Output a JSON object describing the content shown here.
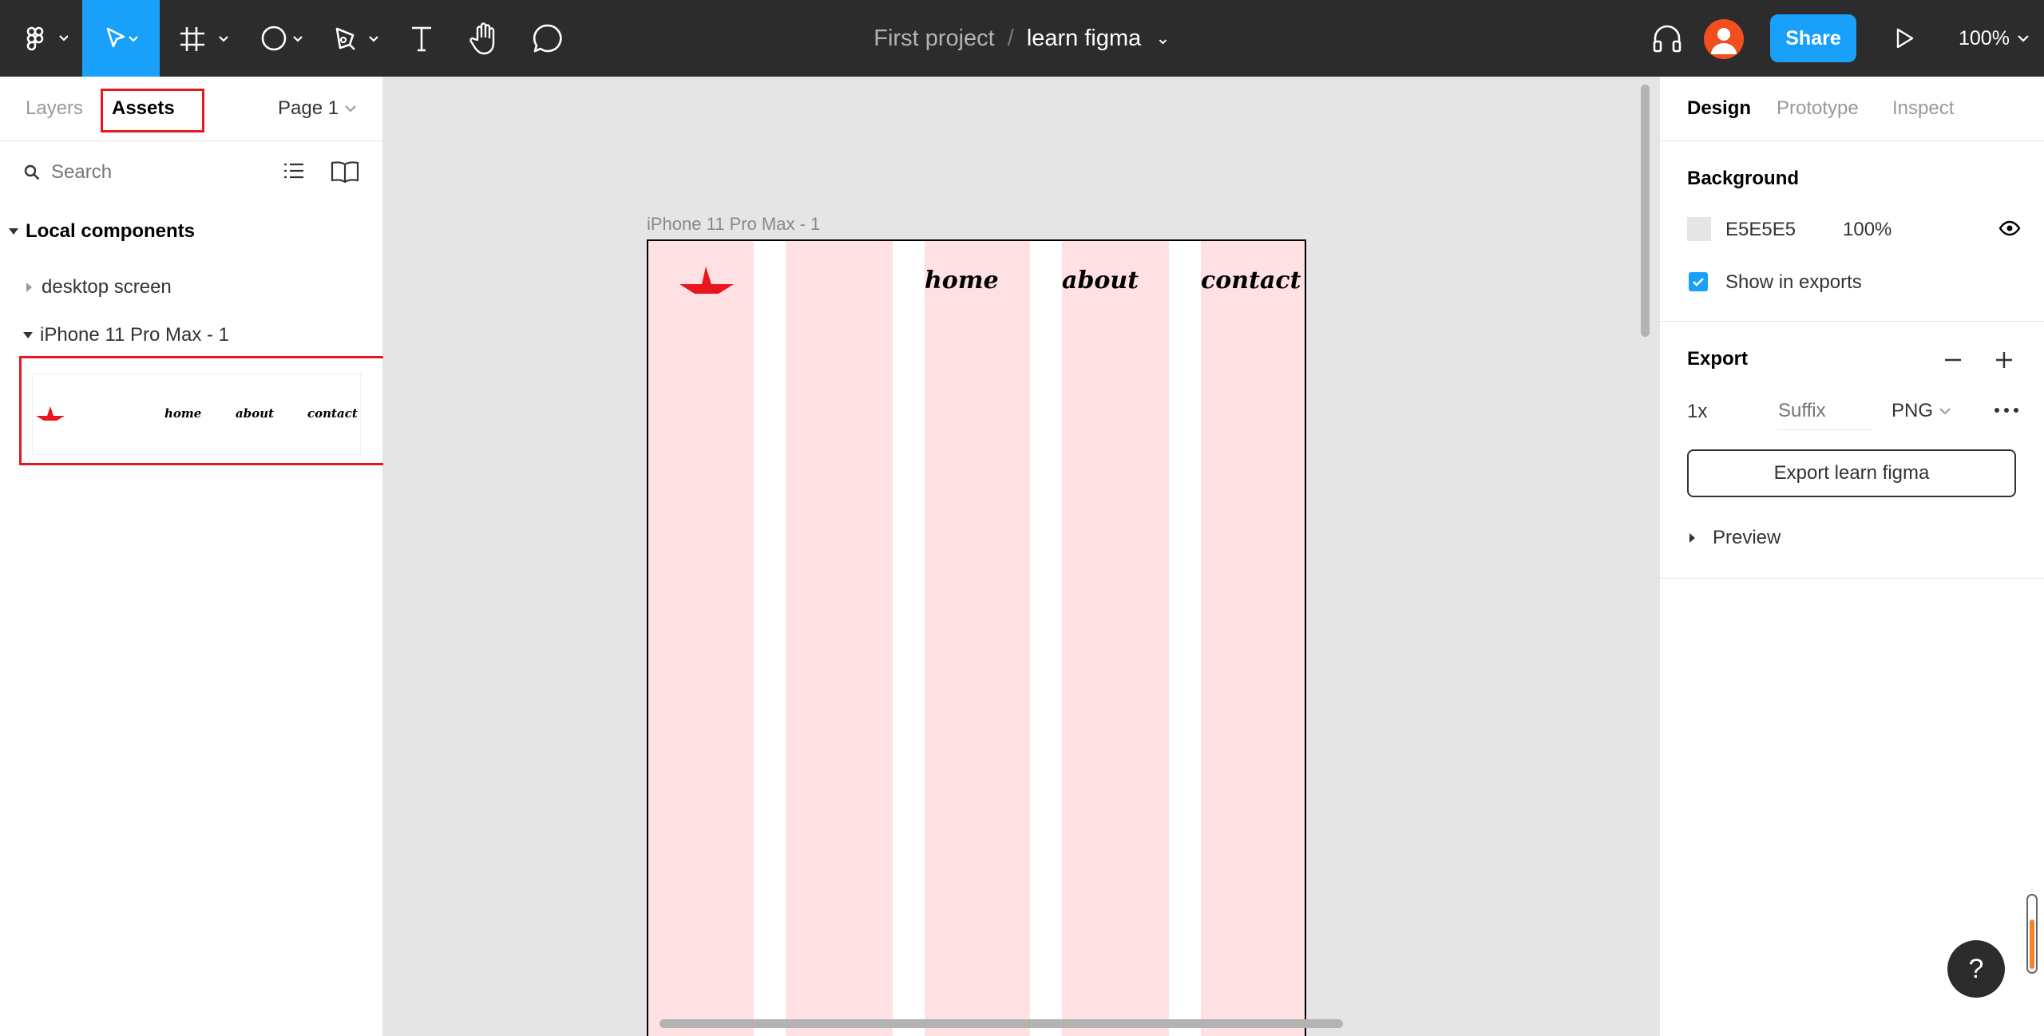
{
  "toolbar": {
    "project": "First project",
    "separator": "/",
    "file_name": "learn figma",
    "share_label": "Share",
    "zoom": "100%",
    "icons": [
      "figma-menu-icon",
      "move-tool-icon",
      "frame-tool-icon",
      "shape-tool-icon",
      "pen-tool-icon",
      "text-tool-icon",
      "hand-tool-icon",
      "comment-tool-icon",
      "headphones-icon",
      "avatar-icon",
      "play-icon"
    ]
  },
  "left_panel": {
    "tabs": {
      "layers": "Layers",
      "assets": "Assets"
    },
    "page": "Page 1",
    "search_placeholder": "Search",
    "section_title": "Local components",
    "components": [
      {
        "label": "desktop screen"
      },
      {
        "label": "iPhone 11 Pro Max - 1"
      }
    ],
    "preview_nav": [
      "home",
      "about",
      "contact"
    ]
  },
  "canvas": {
    "frame_label": "iPhone 11 Pro Max - 1",
    "nav": [
      "home",
      "about",
      "contact"
    ],
    "logo_color": "#e8161d",
    "column_color": "#ffe1e3"
  },
  "right_panel": {
    "tabs": {
      "design": "Design",
      "prototype": "Prototype",
      "inspect": "Inspect"
    },
    "background_title": "Background",
    "bg_hex": "E5E5E5",
    "bg_opacity": "100%",
    "show_in_exports": "Show in exports",
    "export_title": "Export",
    "export_scale": "1x",
    "suffix_placeholder": "Suffix",
    "format": "PNG",
    "export_button": "Export learn figma",
    "preview_label": "Preview"
  },
  "help_label": "?"
}
